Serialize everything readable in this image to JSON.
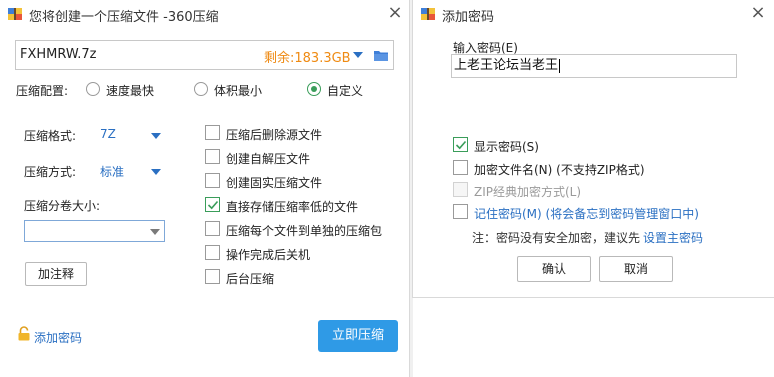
{
  "left_window": {
    "title": "您将创建一个压缩文件 -360压缩",
    "close_glyph": "×",
    "file": {
      "name": "FXHMRW.7z",
      "free_space": "剩余:183.3GB"
    },
    "config": {
      "label": "压缩配置:",
      "options": [
        {
          "label": "速度最快",
          "selected": false
        },
        {
          "label": "体积最小",
          "selected": false
        },
        {
          "label": "自定义",
          "selected": true
        }
      ]
    },
    "format": {
      "label": "压缩格式:",
      "value": "7Z"
    },
    "method": {
      "label": "压缩方式:",
      "value": "标准"
    },
    "split": {
      "label": "压缩分卷大小:",
      "value": ""
    },
    "add_comment_button": "加注释",
    "options": [
      {
        "label": "压缩后删除源文件",
        "checked": false
      },
      {
        "label": "创建自解压文件",
        "checked": false
      },
      {
        "label": "创建固实压缩文件",
        "checked": false
      },
      {
        "label": "直接存储压缩率低的文件",
        "checked": true
      },
      {
        "label": "压缩每个文件到单独的压缩包",
        "checked": false
      },
      {
        "label": "操作完成后关机",
        "checked": false
      },
      {
        "label": "后台压缩",
        "checked": false
      }
    ],
    "add_password_link": "添加密码",
    "compress_button": "立即压缩"
  },
  "right_window": {
    "title": "添加密码",
    "close_glyph": "×",
    "password_label": "输入密码(E)",
    "password_value": "上老王论坛当老王",
    "options": [
      {
        "label": "显示密码(S)",
        "checked": true,
        "disabled": false
      },
      {
        "label": "加密文件名(N) (不支持ZIP格式)",
        "checked": false,
        "disabled": false
      },
      {
        "label": "ZIP经典加密方式(L)",
        "checked": false,
        "disabled": true
      },
      {
        "label": "记住密码(M) (将会备忘到密码管理窗口中)",
        "checked": false,
        "disabled": false
      }
    ],
    "note_text": "注：密码没有安全加密，建议先",
    "note_link": "设置主密码",
    "ok_button": "确认",
    "cancel_button": "取消"
  },
  "colors": {
    "accent_blue": "#2f9ae6",
    "link_blue": "#2a6fc2",
    "check_green": "#3a9d5a",
    "free_space_orange": "#ef8a12"
  }
}
